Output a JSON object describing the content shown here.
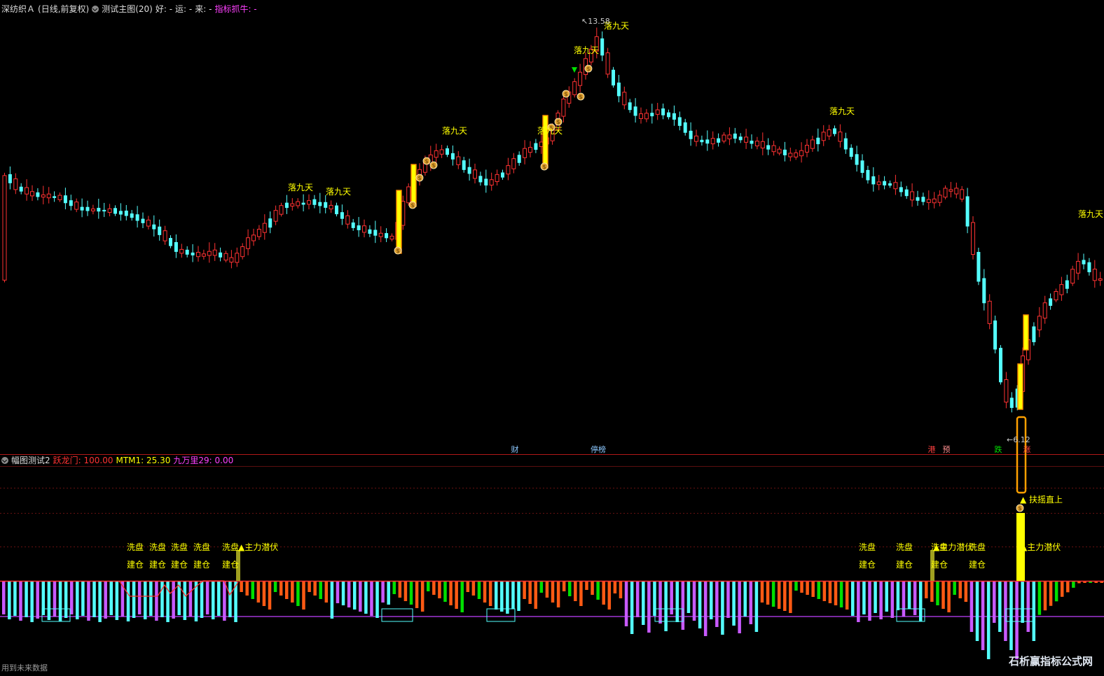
{
  "header_main": {
    "stock": "深纺织Ａ",
    "mode": "(日线,前复权)",
    "indicator": "测试主图(20)",
    "hao": "好: -",
    "yun": "运: -",
    "lai": "来: -",
    "zhibiao": "指标抓牛: -"
  },
  "header_sub": {
    "title": "幅图测试2",
    "yuelongmen": "跃龙门: 100.00",
    "mtm1": "MTM1: 25.30",
    "jiuwanli": "九万里29: 0.00"
  },
  "price_labels": {
    "high": "13.58",
    "low": "6.12"
  },
  "signal_label": "落九天",
  "sub_labels": {
    "xipan": "洗盘",
    "jiancang": "建仓",
    "zhuli": "主力潜伏",
    "fuyao": "扶摇直上"
  },
  "markers": [
    "财",
    "停榜",
    "港",
    "预",
    "跌",
    "涨"
  ],
  "footer": "用到未来数据",
  "watermark": "石析赢指标公式网",
  "colors": {
    "up": "#ff3232",
    "down": "#54ffff",
    "yellow": "#ffff00",
    "purple": "#c85aff",
    "orange": "#ff5a14",
    "green": "#00e000"
  }
}
